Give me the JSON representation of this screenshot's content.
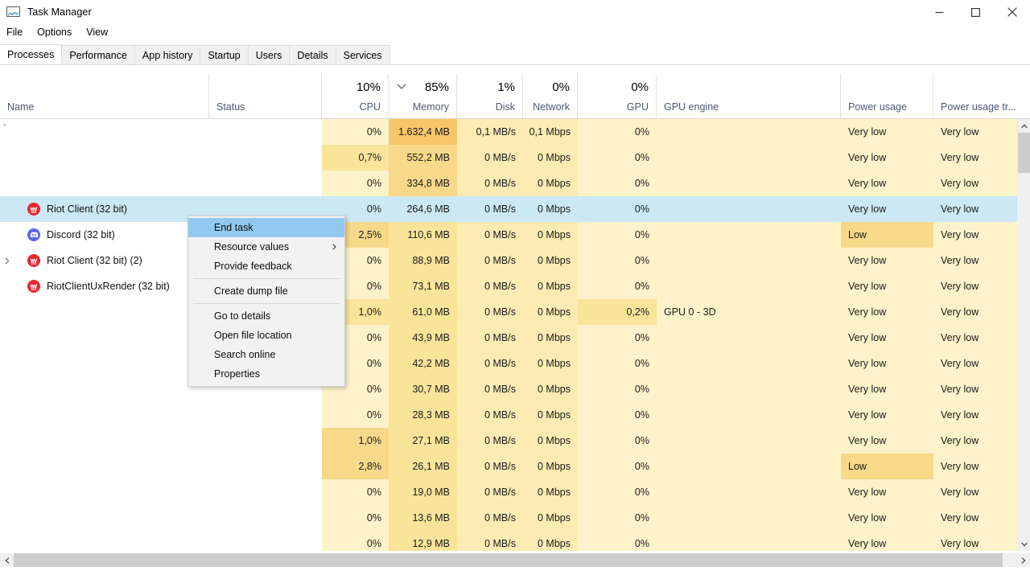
{
  "window": {
    "title": "Task Manager",
    "icon": "task-manager-icon",
    "minimize_label": "Minimize",
    "maximize_label": "Maximize",
    "close_label": "Close"
  },
  "menu": {
    "items": [
      {
        "label": "File"
      },
      {
        "label": "Options"
      },
      {
        "label": "View"
      }
    ]
  },
  "tabs": {
    "active": "Processes",
    "items": [
      {
        "label": "Processes"
      },
      {
        "label": "Performance"
      },
      {
        "label": "App history"
      },
      {
        "label": "Startup"
      },
      {
        "label": "Users"
      },
      {
        "label": "Details"
      },
      {
        "label": "Services"
      }
    ]
  },
  "columns": {
    "name": {
      "label": "Name",
      "pct": ""
    },
    "status": {
      "label": "Status",
      "pct": ""
    },
    "cpu": {
      "label": "CPU",
      "pct": "10%"
    },
    "memory": {
      "label": "Memory",
      "pct": "85%",
      "sorted": "descending"
    },
    "disk": {
      "label": "Disk",
      "pct": "1%"
    },
    "network": {
      "label": "Network",
      "pct": "0%"
    },
    "gpu": {
      "label": "GPU",
      "pct": "0%"
    },
    "gpu_engine": {
      "label": "GPU engine",
      "pct": ""
    },
    "power_usage": {
      "label": "Power usage",
      "pct": ""
    },
    "power_usage_trend": {
      "label": "Power usage tr...",
      "pct": ""
    }
  },
  "colors": {
    "heat_lightest": "#fdf3ca",
    "heat_light": "#fcecb4",
    "heat_mid": "#fae49a",
    "heat_strong": "#f8d98a",
    "heat_strongest": "#f5c66a",
    "selection": "#cce8f5",
    "menu_highlight": "#91c9f0",
    "riot_red": "#e8262c",
    "discord_blurple": "#5865f2",
    "header_label": "#4a5a73"
  },
  "rows": [
    {
      "name": "",
      "icon": "",
      "indent": false,
      "selected": false,
      "partial": true,
      "status": "",
      "cpu": "0%",
      "memory": "1.632,4 MB",
      "disk": "0,1 MB/s",
      "network": "0,1 Mbps",
      "gpu": "0%",
      "gpu_engine": "",
      "power": "Very low",
      "power_trend": "Very low",
      "heat": {
        "cpu": "heat_lightest",
        "memory": "heat_strongest",
        "disk": "heat_light",
        "network": "heat_light",
        "gpu": "heat_lightest"
      }
    },
    {
      "name": "",
      "icon": "",
      "indent": false,
      "selected": false,
      "partial": false,
      "status": "",
      "cpu": "0,7%",
      "memory": "552,2 MB",
      "disk": "0 MB/s",
      "network": "0 Mbps",
      "gpu": "0%",
      "gpu_engine": "",
      "power": "Very low",
      "power_trend": "Very low",
      "heat": {
        "cpu": "heat_mid",
        "memory": "heat_strong",
        "disk": "heat_light",
        "network": "heat_light",
        "gpu": "heat_lightest"
      }
    },
    {
      "name": "",
      "icon": "",
      "indent": false,
      "selected": false,
      "partial": false,
      "status": "",
      "cpu": "0%",
      "memory": "334,8 MB",
      "disk": "0 MB/s",
      "network": "0 Mbps",
      "gpu": "0%",
      "gpu_engine": "",
      "power": "Very low",
      "power_trend": "Very low",
      "heat": {
        "cpu": "heat_lightest",
        "memory": "heat_strong",
        "disk": "heat_light",
        "network": "heat_light",
        "gpu": "heat_lightest"
      }
    },
    {
      "name": "Riot Client (32 bit)",
      "icon": "riot-icon",
      "indent": false,
      "selected": true,
      "partial": false,
      "status": "",
      "cpu": "0%",
      "memory": "264,6 MB",
      "disk": "0 MB/s",
      "network": "0 Mbps",
      "gpu": "0%",
      "gpu_engine": "",
      "power": "Very low",
      "power_trend": "Very low",
      "heat": {
        "cpu": "",
        "memory": "",
        "disk": "",
        "network": "",
        "gpu": ""
      }
    },
    {
      "name": "Discord (32 bit)",
      "icon": "discord-icon",
      "indent": false,
      "selected": false,
      "partial": false,
      "status": "",
      "cpu": "2,5%",
      "memory": "110,6 MB",
      "disk": "0 MB/s",
      "network": "0 Mbps",
      "gpu": "0%",
      "gpu_engine": "",
      "power": "Low",
      "power_trend": "Very low",
      "heat": {
        "cpu": "heat_strong",
        "memory": "heat_mid",
        "disk": "heat_light",
        "network": "heat_light",
        "gpu": "heat_lightest",
        "power": "heat_strong"
      }
    },
    {
      "name": "Riot Client (32 bit) (2)",
      "icon": "riot-icon",
      "indent": true,
      "expandable": true,
      "selected": false,
      "partial": false,
      "status": "",
      "cpu": "0%",
      "memory": "88,9 MB",
      "disk": "0 MB/s",
      "network": "0 Mbps",
      "gpu": "0%",
      "gpu_engine": "",
      "power": "Very low",
      "power_trend": "Very low",
      "heat": {
        "cpu": "heat_lightest",
        "memory": "heat_mid",
        "disk": "heat_light",
        "network": "heat_light",
        "gpu": "heat_lightest"
      }
    },
    {
      "name": "RiotClientUxRender (32 bit)",
      "icon": "riot-icon",
      "indent": false,
      "selected": false,
      "partial": false,
      "status": "",
      "cpu": "0%",
      "memory": "73,1 MB",
      "disk": "0 MB/s",
      "network": "0 Mbps",
      "gpu": "0%",
      "gpu_engine": "",
      "power": "Very low",
      "power_trend": "Very low",
      "heat": {
        "cpu": "heat_lightest",
        "memory": "heat_mid",
        "disk": "heat_light",
        "network": "heat_light",
        "gpu": "heat_lightest"
      }
    },
    {
      "name": "",
      "icon": "",
      "indent": false,
      "selected": false,
      "partial": false,
      "status": "",
      "cpu": "1,0%",
      "memory": "61,0 MB",
      "disk": "0 MB/s",
      "network": "0 Mbps",
      "gpu": "0,2%",
      "gpu_engine": "GPU 0 - 3D",
      "power": "Very low",
      "power_trend": "Very low",
      "heat": {
        "cpu": "heat_mid",
        "memory": "heat_mid",
        "disk": "heat_light",
        "network": "heat_light",
        "gpu": "heat_mid"
      }
    },
    {
      "name": "",
      "icon": "",
      "indent": false,
      "selected": false,
      "partial": false,
      "status": "",
      "cpu": "0%",
      "memory": "43,9 MB",
      "disk": "0 MB/s",
      "network": "0 Mbps",
      "gpu": "0%",
      "gpu_engine": "",
      "power": "Very low",
      "power_trend": "Very low",
      "heat": {
        "cpu": "heat_lightest",
        "memory": "heat_mid",
        "disk": "heat_light",
        "network": "heat_light",
        "gpu": "heat_lightest"
      }
    },
    {
      "name": "",
      "icon": "",
      "indent": false,
      "selected": false,
      "partial": false,
      "status": "",
      "cpu": "0%",
      "memory": "42,2 MB",
      "disk": "0 MB/s",
      "network": "0 Mbps",
      "gpu": "0%",
      "gpu_engine": "",
      "power": "Very low",
      "power_trend": "Very low",
      "heat": {
        "cpu": "heat_lightest",
        "memory": "heat_mid",
        "disk": "heat_light",
        "network": "heat_light",
        "gpu": "heat_lightest"
      }
    },
    {
      "name": "",
      "icon": "",
      "indent": false,
      "selected": false,
      "partial": false,
      "status": "",
      "cpu": "0%",
      "memory": "30,7 MB",
      "disk": "0 MB/s",
      "network": "0 Mbps",
      "gpu": "0%",
      "gpu_engine": "",
      "power": "Very low",
      "power_trend": "Very low",
      "heat": {
        "cpu": "heat_lightest",
        "memory": "heat_mid",
        "disk": "heat_light",
        "network": "heat_light",
        "gpu": "heat_lightest"
      }
    },
    {
      "name": "",
      "icon": "",
      "indent": false,
      "selected": false,
      "partial": false,
      "status": "",
      "cpu": "0%",
      "memory": "28,3 MB",
      "disk": "0 MB/s",
      "network": "0 Mbps",
      "gpu": "0%",
      "gpu_engine": "",
      "power": "Very low",
      "power_trend": "Very low",
      "heat": {
        "cpu": "heat_lightest",
        "memory": "heat_mid",
        "disk": "heat_light",
        "network": "heat_light",
        "gpu": "heat_lightest"
      }
    },
    {
      "name": "",
      "icon": "",
      "indent": false,
      "selected": false,
      "partial": false,
      "status": "",
      "cpu": "1,0%",
      "memory": "27,1 MB",
      "disk": "0 MB/s",
      "network": "0 Mbps",
      "gpu": "0%",
      "gpu_engine": "",
      "power": "Very low",
      "power_trend": "Very low",
      "heat": {
        "cpu": "heat_strong",
        "memory": "heat_mid",
        "disk": "heat_light",
        "network": "heat_light",
        "gpu": "heat_lightest"
      }
    },
    {
      "name": "",
      "icon": "",
      "indent": false,
      "selected": false,
      "partial": false,
      "status": "",
      "cpu": "2,8%",
      "memory": "26,1 MB",
      "disk": "0 MB/s",
      "network": "0 Mbps",
      "gpu": "0%",
      "gpu_engine": "",
      "power": "Low",
      "power_trend": "Very low",
      "heat": {
        "cpu": "heat_strong",
        "memory": "heat_mid",
        "disk": "heat_light",
        "network": "heat_light",
        "gpu": "heat_lightest",
        "power": "heat_strong"
      }
    },
    {
      "name": "",
      "icon": "",
      "indent": false,
      "selected": false,
      "partial": false,
      "status": "",
      "cpu": "0%",
      "memory": "19,0 MB",
      "disk": "0 MB/s",
      "network": "0 Mbps",
      "gpu": "0%",
      "gpu_engine": "",
      "power": "Very low",
      "power_trend": "Very low",
      "heat": {
        "cpu": "heat_lightest",
        "memory": "heat_mid",
        "disk": "heat_light",
        "network": "heat_light",
        "gpu": "heat_lightest"
      }
    },
    {
      "name": "",
      "icon": "",
      "indent": false,
      "selected": false,
      "partial": false,
      "status": "",
      "cpu": "0%",
      "memory": "13,6 MB",
      "disk": "0 MB/s",
      "network": "0 Mbps",
      "gpu": "0%",
      "gpu_engine": "",
      "power": "Very low",
      "power_trend": "Very low",
      "heat": {
        "cpu": "heat_lightest",
        "memory": "heat_mid",
        "disk": "heat_light",
        "network": "heat_light",
        "gpu": "heat_lightest"
      }
    },
    {
      "name": "",
      "icon": "",
      "indent": false,
      "selected": false,
      "partial": false,
      "status": "",
      "cpu": "0%",
      "memory": "12,9 MB",
      "disk": "0 MB/s",
      "network": "0 Mbps",
      "gpu": "0%",
      "gpu_engine": "",
      "power": "Very low",
      "power_trend": "Very low",
      "heat": {
        "cpu": "heat_lightest",
        "memory": "heat_mid",
        "disk": "heat_light",
        "network": "heat_light",
        "gpu": "heat_lightest"
      }
    }
  ],
  "context_menu": {
    "items": [
      {
        "label": "End task",
        "highlighted": true,
        "submenu": false,
        "separator_after": false
      },
      {
        "label": "Resource values",
        "highlighted": false,
        "submenu": true,
        "separator_after": false
      },
      {
        "label": "Provide feedback",
        "highlighted": false,
        "submenu": false,
        "separator_after": true
      },
      {
        "label": "Create dump file",
        "highlighted": false,
        "submenu": false,
        "separator_after": true
      },
      {
        "label": "Go to details",
        "highlighted": false,
        "submenu": false,
        "separator_after": false
      },
      {
        "label": "Open file location",
        "highlighted": false,
        "submenu": false,
        "separator_after": false
      },
      {
        "label": "Search online",
        "highlighted": false,
        "submenu": false,
        "separator_after": false
      },
      {
        "label": "Properties",
        "highlighted": false,
        "submenu": false,
        "separator_after": false
      }
    ]
  }
}
